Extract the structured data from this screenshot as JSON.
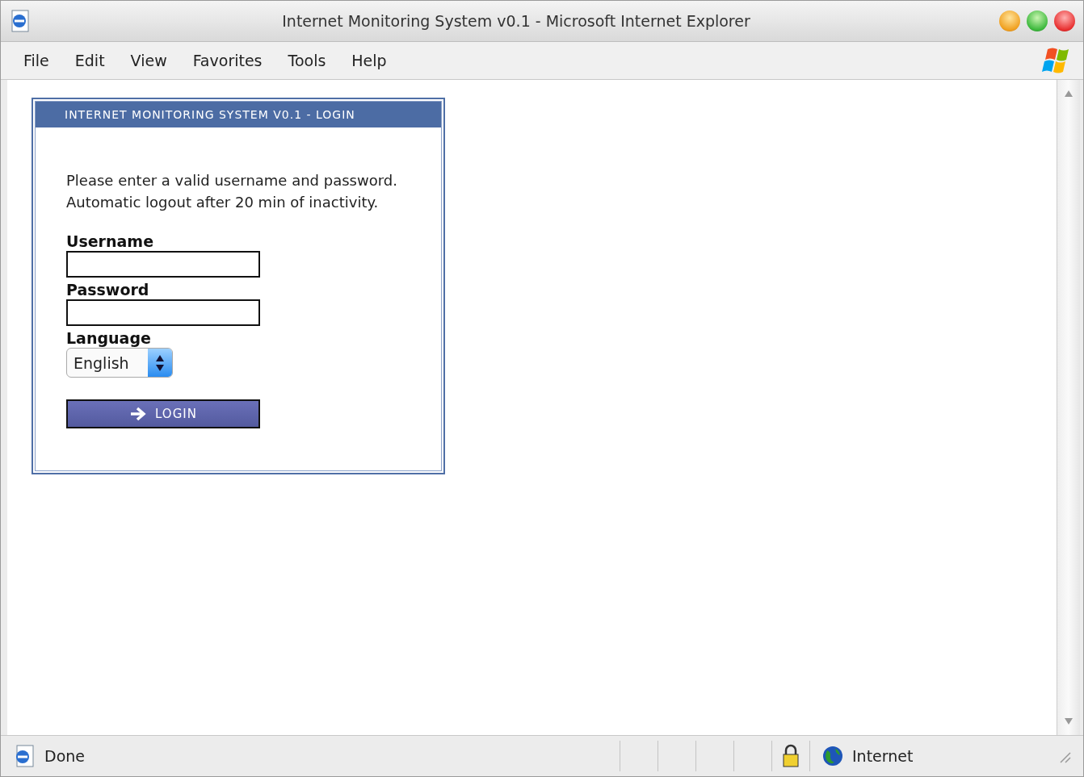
{
  "window": {
    "title": "Internet Monitoring System v0.1 - Microsoft Internet Explorer"
  },
  "menu": [
    {
      "label": "File"
    },
    {
      "label": "Edit"
    },
    {
      "label": "View"
    },
    {
      "label": "Favorites"
    },
    {
      "label": "Tools"
    },
    {
      "label": "Help"
    }
  ],
  "login_panel": {
    "title": "INTERNET MONITORING SYSTEM V0.1 - LOGIN",
    "message": [
      "Please enter a valid username and password.",
      "Automatic logout after 20 min of inactivity."
    ],
    "fields": [
      {
        "kind": "text",
        "label": "Username"
      },
      {
        "kind": "password",
        "label": "Password"
      },
      {
        "kind": "select",
        "label": "Language",
        "value": "English"
      }
    ],
    "button": "LOGIN"
  },
  "status_bar": {
    "status": "Done",
    "zone": "Internet"
  }
}
